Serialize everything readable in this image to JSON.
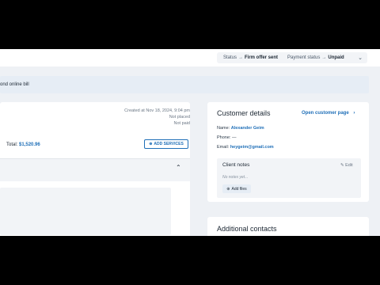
{
  "header": {
    "status_label": "Status",
    "status_value": "Firm offer sent",
    "payment_label": "Payment status",
    "payment_value": "Unpaid"
  },
  "banner": {
    "text": "ond online bill"
  },
  "job": {
    "created": "Created at Nov 18, 2024, 9:04 pm",
    "not_placed": "Not placed",
    "not_paid": "Not paid",
    "total_label": "Total:",
    "total_value": "$1,520.96",
    "add_services": "ADD SERVICES"
  },
  "customer": {
    "title": "Customer details",
    "open_page": "Open customer page",
    "name_label": "Name:",
    "name_value": "Alexander Geim",
    "phone_label": "Phone:",
    "phone_value": "—",
    "email_label": "Email:",
    "email_value": "heygeim@gmail.com"
  },
  "notes": {
    "title": "Client notes",
    "edit": "Edit",
    "empty": "No notes yet...",
    "add_files": "Add files"
  },
  "contacts": {
    "title": "Additional contacts"
  },
  "colors": {
    "accent": "#1f6fb8",
    "background": "#eef1f5"
  }
}
